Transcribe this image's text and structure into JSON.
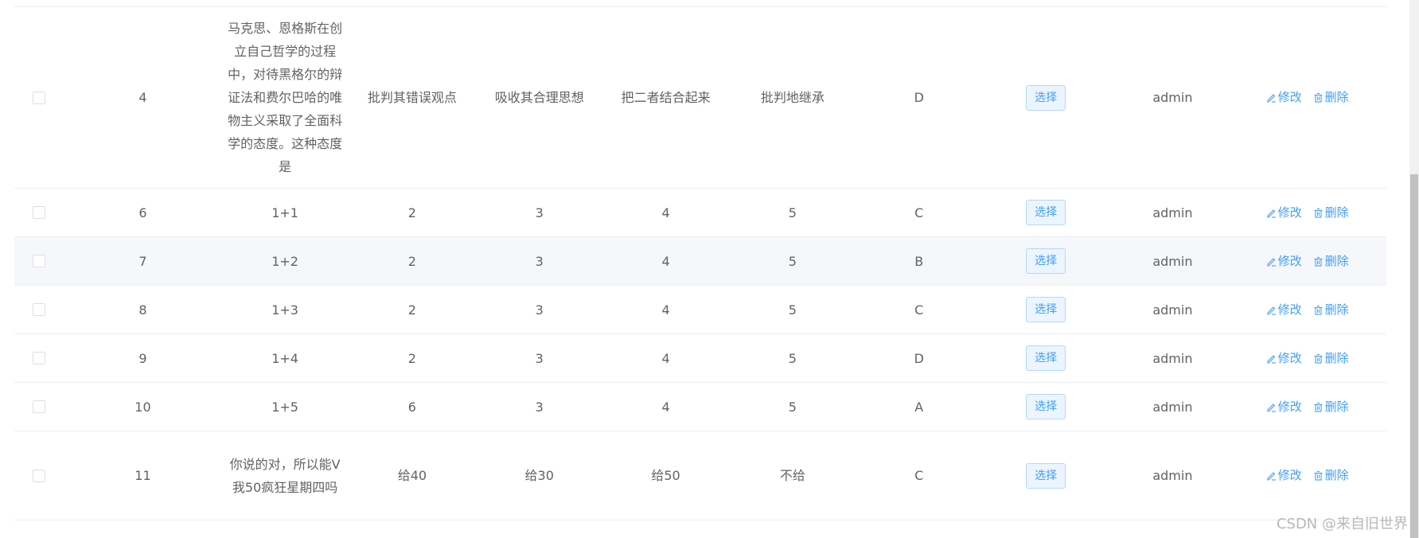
{
  "table": {
    "rows": [
      {
        "id": "4",
        "title": "马克思、恩格斯在创立自己哲学的过程中，对待黑格尔的辩证法和费尔巴哈的唯物主义采取了全面科学的态度。这种态度是",
        "a": "批判其错误观点",
        "b": "吸收其合理思想",
        "c": "把二者结合起来",
        "d": "批判地继承",
        "answer": "D",
        "select_label": "选择",
        "user": "admin",
        "edit_label": "修改",
        "delete_label": "删除"
      },
      {
        "id": "6",
        "title": "1+1",
        "a": "2",
        "b": "3",
        "c": "4",
        "d": "5",
        "answer": "C",
        "select_label": "选择",
        "user": "admin",
        "edit_label": "修改",
        "delete_label": "删除"
      },
      {
        "id": "7",
        "title": "1+2",
        "a": "2",
        "b": "3",
        "c": "4",
        "d": "5",
        "answer": "B",
        "select_label": "选择",
        "user": "admin",
        "edit_label": "修改",
        "delete_label": "删除"
      },
      {
        "id": "8",
        "title": "1+3",
        "a": "2",
        "b": "3",
        "c": "4",
        "d": "5",
        "answer": "C",
        "select_label": "选择",
        "user": "admin",
        "edit_label": "修改",
        "delete_label": "删除"
      },
      {
        "id": "9",
        "title": "1+4",
        "a": "2",
        "b": "3",
        "c": "4",
        "d": "5",
        "answer": "D",
        "select_label": "选择",
        "user": "admin",
        "edit_label": "修改",
        "delete_label": "删除"
      },
      {
        "id": "10",
        "title": "1+5",
        "a": "6",
        "b": "3",
        "c": "4",
        "d": "5",
        "answer": "A",
        "select_label": "选择",
        "user": "admin",
        "edit_label": "修改",
        "delete_label": "删除"
      },
      {
        "id": "11",
        "title": "你说的对，所以能V我50疯狂星期四吗",
        "a": "给40",
        "b": "给30",
        "c": "给50",
        "d": "不给",
        "answer": "C",
        "select_label": "选择",
        "user": "admin",
        "edit_label": "修改",
        "delete_label": "删除"
      }
    ]
  },
  "watermark": "CSDN @来自旧世界",
  "colors": {
    "link": "#409eff",
    "border": "#ebeef5",
    "hover_row": "#f5f7fa",
    "text": "#606266"
  },
  "icons": {
    "edit": "edit-icon",
    "delete": "delete-icon"
  }
}
